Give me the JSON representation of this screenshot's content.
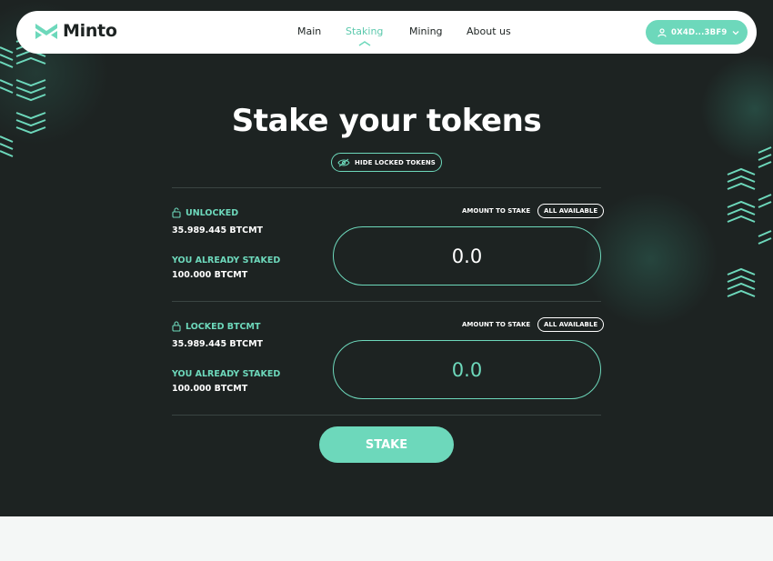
{
  "header": {
    "brand": "Minto",
    "nav": [
      {
        "label": "Main",
        "active": false
      },
      {
        "label": "Staking",
        "active": true
      },
      {
        "label": "Mining",
        "active": false
      },
      {
        "label": "About us",
        "active": false
      }
    ],
    "wallet_address": "0X4D...3BF9"
  },
  "hero": {
    "title": "Stake your tokens",
    "hide_locked_label": "HIDE LOCKED TOKENS"
  },
  "sections": [
    {
      "balance_label": "UNLOCKED",
      "balance_value": "35.989.445 BTCMT",
      "staked_label": "YOU ALREADY STAKED",
      "staked_value": "100.000 BTCMT",
      "amount_label": "AMOUNT TO STAKE",
      "all_available_label": "ALL AVAILABLE",
      "amount_value": "0.0"
    },
    {
      "balance_label": "LOCKED BTCMT",
      "balance_value": "35.989.445 BTCMT",
      "staked_label": "YOU ALREADY STAKED",
      "staked_value": "100.000 BTCMT",
      "amount_label": "AMOUNT TO STAKE",
      "all_available_label": "ALL AVAILABLE",
      "amount_value": "0.0"
    }
  ],
  "stake_button_label": "STAKE",
  "colors": {
    "accent": "#6dd8bb",
    "background_dark": "#1d2322",
    "page_light": "#f4f7f6"
  },
  "icons": [
    "minto-logo-icon",
    "user-icon",
    "chevron-down-icon",
    "eye-off-icon",
    "unlock-icon",
    "lock-icon"
  ]
}
